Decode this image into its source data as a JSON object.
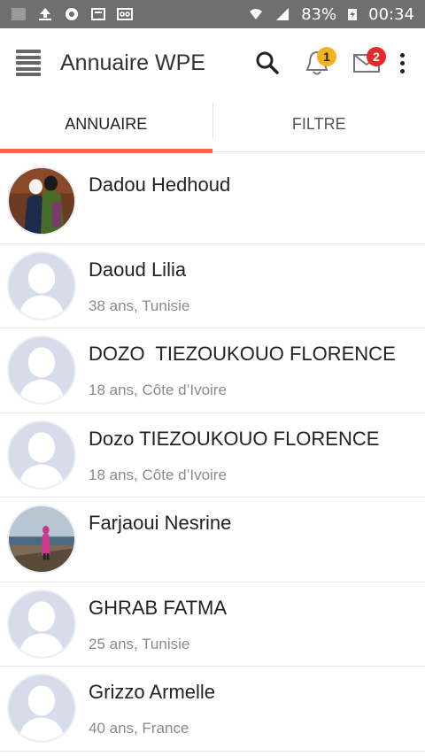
{
  "status_bar": {
    "battery": "83%",
    "time": "00:34",
    "icons": [
      "square-icon",
      "upload-icon",
      "chrome-icon",
      "sd-icon",
      "voicemail-icon",
      "wifi-icon",
      "signal-icon",
      "battery-charging-icon"
    ]
  },
  "app_bar": {
    "title": "Annuaire WPE",
    "notifications_badge": "1",
    "messages_badge": "2"
  },
  "tabs": [
    {
      "label": "ANNUAIRE",
      "active": true
    },
    {
      "label": "FILTRE",
      "active": false
    }
  ],
  "colors": {
    "accent": "#ee6b4d",
    "status_bar": "#6f6f6f",
    "badge_orange": "#f1b320",
    "badge_red": "#e42a2a"
  },
  "members": [
    {
      "name": "Dadou Hedhoud",
      "meta": "",
      "avatar": "photo-two-women"
    },
    {
      "name": "Daoud Lilia",
      "meta": "38 ans, Tunisie",
      "avatar": "placeholder"
    },
    {
      "name": "DOZO  TIEZOUKOUO FLORENCE",
      "meta": "18 ans, Côte d’Ivoire",
      "avatar": "placeholder"
    },
    {
      "name": "Dozo TIEZOUKOUO FLORENCE",
      "meta": "18 ans, Côte d’Ivoire",
      "avatar": "placeholder"
    },
    {
      "name": "Farjaoui Nesrine",
      "meta": "",
      "avatar": "photo-seaside"
    },
    {
      "name": "GHRAB FATMA",
      "meta": "25 ans, Tunisie",
      "avatar": "placeholder"
    },
    {
      "name": "Grizzo Armelle",
      "meta": "40 ans, France",
      "avatar": "placeholder"
    }
  ]
}
